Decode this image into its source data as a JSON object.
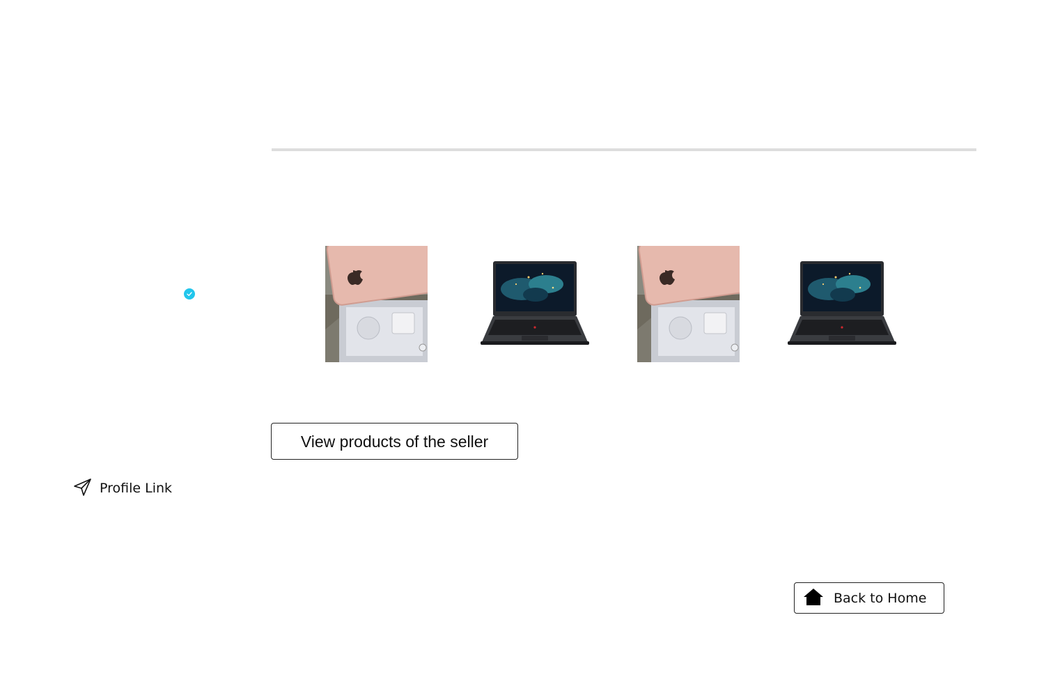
{
  "seller": {
    "verified_icon": "verified-check-icon",
    "verified_color": "#22c6ec"
  },
  "products": [
    {
      "name": "product-thumbnail-iphone",
      "icon": "iphone-box-photo"
    },
    {
      "name": "product-thumbnail-laptop",
      "icon": "laptop-photo"
    },
    {
      "name": "product-thumbnail-iphone",
      "icon": "iphone-box-photo"
    },
    {
      "name": "product-thumbnail-laptop",
      "icon": "laptop-photo"
    }
  ],
  "actions": {
    "view_products_label": "View products of the seller",
    "profile_link_label": "Profile Link",
    "profile_link_icon": "send-icon",
    "back_home_label": "Back to Home",
    "back_home_icon": "home-icon"
  }
}
